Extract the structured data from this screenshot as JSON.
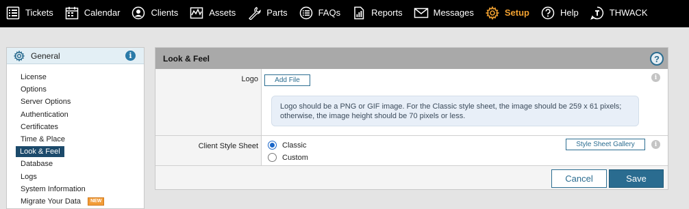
{
  "nav": {
    "items": [
      {
        "label": "Tickets",
        "icon": "list-icon"
      },
      {
        "label": "Calendar",
        "icon": "calendar-icon"
      },
      {
        "label": "Clients",
        "icon": "user-icon"
      },
      {
        "label": "Assets",
        "icon": "chart-icon"
      },
      {
        "label": "Parts",
        "icon": "wrench-icon"
      },
      {
        "label": "FAQs",
        "icon": "list-circle-icon"
      },
      {
        "label": "Reports",
        "icon": "report-icon"
      },
      {
        "label": "Messages",
        "icon": "envelope-icon"
      },
      {
        "label": "Setup",
        "icon": "gear-icon",
        "active": true
      },
      {
        "label": "Help",
        "icon": "help-icon"
      },
      {
        "label": "THWACK",
        "icon": "thwack-icon"
      }
    ],
    "active_color": "#f0a030"
  },
  "sidebar": {
    "title": "General",
    "info": "i",
    "items": [
      {
        "label": "License"
      },
      {
        "label": "Options"
      },
      {
        "label": "Server Options"
      },
      {
        "label": "Authentication"
      },
      {
        "label": "Certificates"
      },
      {
        "label": "Time & Place"
      },
      {
        "label": "Look & Feel",
        "active": true
      },
      {
        "label": "Database"
      },
      {
        "label": "Logs"
      },
      {
        "label": "System Information"
      },
      {
        "label": "Migrate Your Data",
        "badge": "NEW"
      }
    ]
  },
  "panel": {
    "title": "Look & Feel",
    "help": "?",
    "logo": {
      "label": "Logo",
      "button": "Add File",
      "info": "i",
      "hint": "Logo should be a PNG or GIF image. For the Classic style sheet, the image should be 259 x 61 pixels; otherwise, the image height should be 70 pixels or less."
    },
    "style": {
      "label": "Client Style Sheet",
      "button": "Style Sheet Gallery",
      "info": "i",
      "options": [
        {
          "label": "Classic",
          "selected": true
        },
        {
          "label": "Custom",
          "selected": false
        }
      ]
    },
    "footer": {
      "cancel": "Cancel",
      "save": "Save"
    }
  },
  "colors": {
    "nav_bg": "#000000",
    "primary": "#2a6c90",
    "selected_item": "#1c4a6b",
    "badge": "#f29c38"
  }
}
